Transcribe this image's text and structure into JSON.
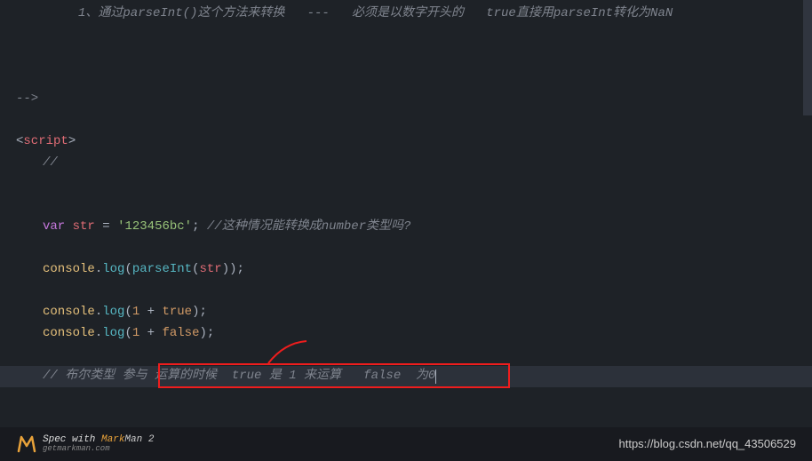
{
  "code": {
    "line1_comment": "1、通过parseInt()这个方法来转换   ---   必须是以数字开头的   true直接用parseInt转化为NaN",
    "line_end_comment": "-->",
    "tag_open": "<",
    "tag_script": "script",
    "tag_close": ">",
    "inline_comment": "//",
    "var_kw": "var",
    "str_name": "str",
    "equals": " = ",
    "str_value": "'123456bc'",
    "semicolon": ";",
    "comment_number": " //这种情况能转换成number类型吗?",
    "console": "console",
    "dot": ".",
    "log": "log",
    "paren_open": "(",
    "paren_close": ")",
    "parseInt": "parseInt",
    "str_ref": "str",
    "one": "1",
    "plus": " + ",
    "true": "true",
    "false": "false",
    "comment_bool": "// 布尔类型 参与 ",
    "comment_bool2": "运算的时候  true 是 1 来运算   false  为0"
  },
  "footer": {
    "spec": "Spec with ",
    "mark": "Mark",
    "man": "Man 2",
    "url": "getmarkman.com",
    "blog_url": "https://blog.csdn.net/qq_43506529"
  }
}
